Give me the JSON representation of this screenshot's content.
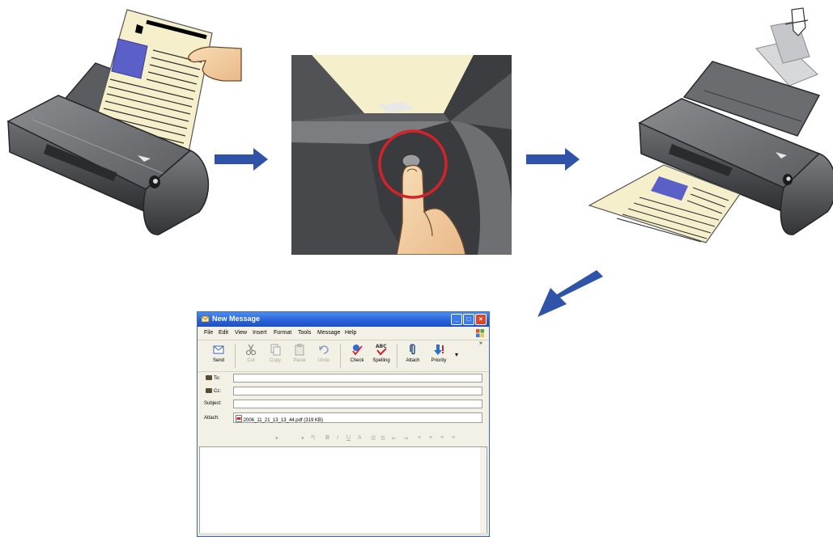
{
  "diagram": {
    "steps": [
      "insert-document",
      "press-scan-button",
      "document-ejected",
      "email-with-attachment"
    ],
    "colors": {
      "arrow": "#2f53a8",
      "highlight": "#d4212a",
      "paper": "#f6efcc",
      "scanner": "#4d4f52",
      "window_title": "#2a62d8"
    }
  },
  "window": {
    "title": "New Message",
    "menu": [
      "File",
      "Edit",
      "View",
      "Insert",
      "Format",
      "Tools",
      "Message",
      "Help"
    ],
    "toolbar": {
      "send": "Send",
      "cut": "Cut",
      "copy": "Copy",
      "paste": "Paste",
      "undo": "Undo",
      "check": "Check",
      "spelling": "Spelling",
      "attach": "Attach",
      "priority": "Priority"
    },
    "fields": {
      "to_label": "To:",
      "to_value": "",
      "cc_label": "Cc:",
      "cc_value": "",
      "subject_label": "Subject:",
      "subject_value": "",
      "attach_label": "Attach:",
      "attach_value": "2006_11_21_13_13_44.pdf (319 KB)"
    },
    "icons": [
      "mail-icon",
      "cut-icon",
      "copy-icon",
      "paste-icon",
      "undo-icon",
      "check-icon",
      "spelling-icon",
      "paperclip-icon",
      "priority-icon",
      "address-book-icon",
      "pdf-file-icon"
    ]
  }
}
